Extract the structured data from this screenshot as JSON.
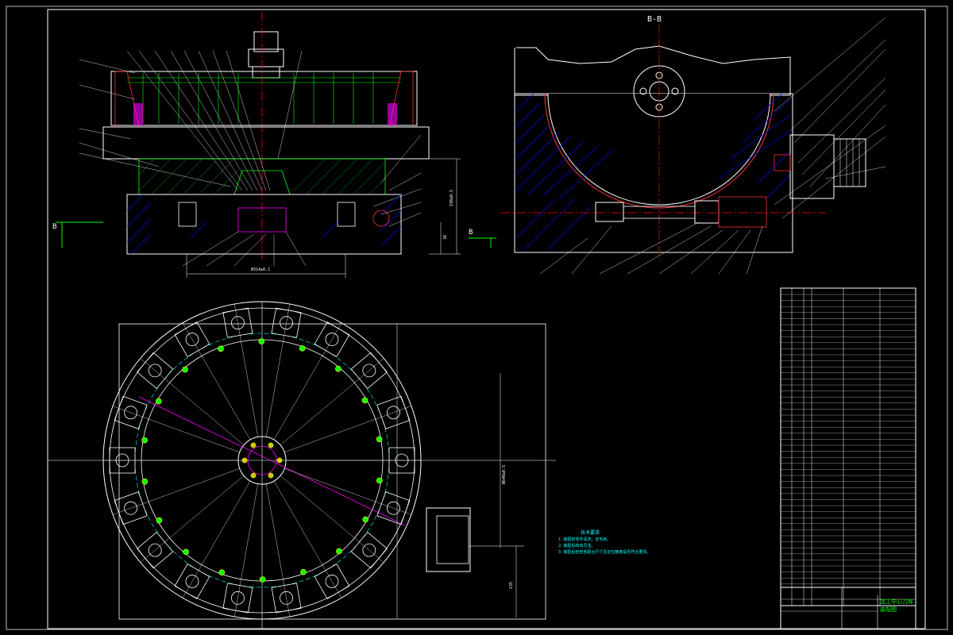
{
  "colors": {
    "background": "#000000",
    "outline": "#ffffff",
    "centerline": "#ff0000",
    "hatch_red": "#ff3030",
    "hatch_green": "#00ff00",
    "blue": "#0000ff",
    "cyan": "#00ffff",
    "magenta": "#ff00ff",
    "yellow": "#ffff00"
  },
  "section_view": {
    "title": "B-B"
  },
  "front_view": {
    "cut_mark_left": "B",
    "cut_mark_right": "B"
  },
  "dimensions": {
    "diameter_bottom": "Ø314±0.1",
    "height_side": "190±0.5",
    "small_height": "38",
    "plan_diameter": "Ø640±0.5",
    "plan_offset": "135"
  },
  "technical_requirements": {
    "title": "技术要求",
    "items": [
      "1. 装配前零件清洗，去毛刺。",
      "2. 装配后转动灵活。",
      "3. 装配后检查各配合尺寸及定位精度是否符合要求。"
    ]
  },
  "title_block": {
    "drawing_name": "加工中心刀库装配图"
  },
  "glyphs": {
    "plus": "+"
  }
}
